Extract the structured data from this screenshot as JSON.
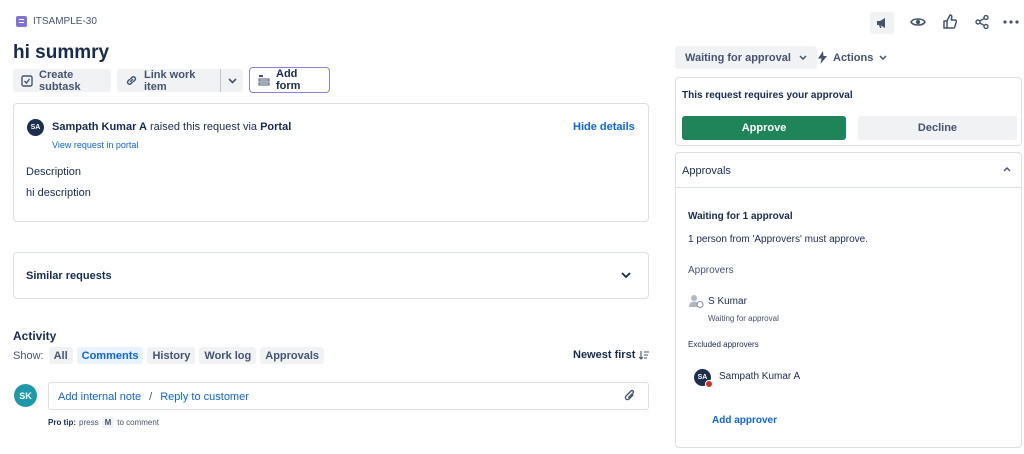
{
  "header": {
    "issue_key": "ITSAMPLE-30",
    "title": "hi summry"
  },
  "toolbar": {
    "create_subtask": "Create subtask",
    "link_work_item": "Link work item",
    "add_form": "Add form"
  },
  "request": {
    "avatar_initials": "SA",
    "requester": "Sampath Kumar A",
    "raised_text": "raised this request via",
    "channel": "Portal",
    "view_link": "View request in portal",
    "hide_details": "Hide details",
    "description_label": "Description",
    "description_value": "hi description"
  },
  "similar": {
    "label": "Similar requests"
  },
  "activity": {
    "title": "Activity",
    "show_label": "Show:",
    "filters": [
      "All",
      "Comments",
      "History",
      "Work log",
      "Approvals"
    ],
    "active_filter": "Comments",
    "sort_label": "Newest first",
    "avatar_initials": "SK",
    "add_internal_note": "Add internal note",
    "separator": "/",
    "reply_to_customer": "Reply to customer",
    "pro_tip_bold": "Pro tip:",
    "pro_tip_press": "press",
    "pro_tip_key": "M",
    "pro_tip_rest": "to comment"
  },
  "status": {
    "label": "Waiting for approval",
    "actions_label": "Actions"
  },
  "approval_prompt": {
    "text": "This request requires your approval",
    "approve": "Approve",
    "decline": "Decline"
  },
  "approvals": {
    "header": "Approvals",
    "waiting_title": "Waiting for 1 approval",
    "waiting_desc": "1 person from 'Approvers' must approve.",
    "approvers_label": "Approvers",
    "approver_name": "S Kumar",
    "approver_status": "Waiting for approval",
    "excluded_label": "Excluded approvers",
    "excluded_avatar": "SA",
    "excluded_name": "Sampath Kumar A",
    "add_approver": "Add approver"
  },
  "colors": {
    "approve_green": "#1f845a",
    "link_blue": "#0c66e4",
    "key_purple": "#8270db"
  }
}
